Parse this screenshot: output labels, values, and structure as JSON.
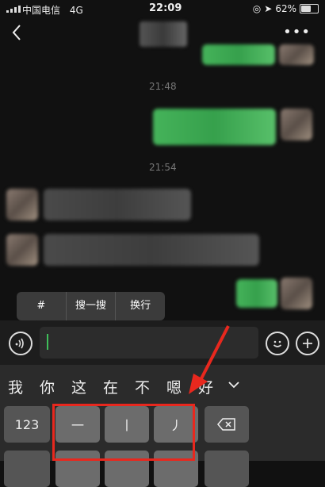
{
  "status": {
    "carrier": "中国电信",
    "network": "4G",
    "time": "22:09",
    "battery": "62%",
    "battery_level": 0.62
  },
  "nav": {
    "more": "•••"
  },
  "chat": {
    "timestamps": [
      "21:48",
      "21:54"
    ]
  },
  "popup": {
    "items": [
      "#",
      "搜一搜",
      "换行"
    ]
  },
  "input": {
    "value": ""
  },
  "keyboard": {
    "candidates": [
      "我",
      "你",
      "这",
      "在",
      "不",
      "嗯",
      "好"
    ],
    "keys": {
      "num": "123",
      "stroke1": "一",
      "stroke2": "丨",
      "stroke3": "丿"
    }
  },
  "colors": {
    "accent_green": "#3fbf5a",
    "annotation_red": "#e8281e"
  }
}
